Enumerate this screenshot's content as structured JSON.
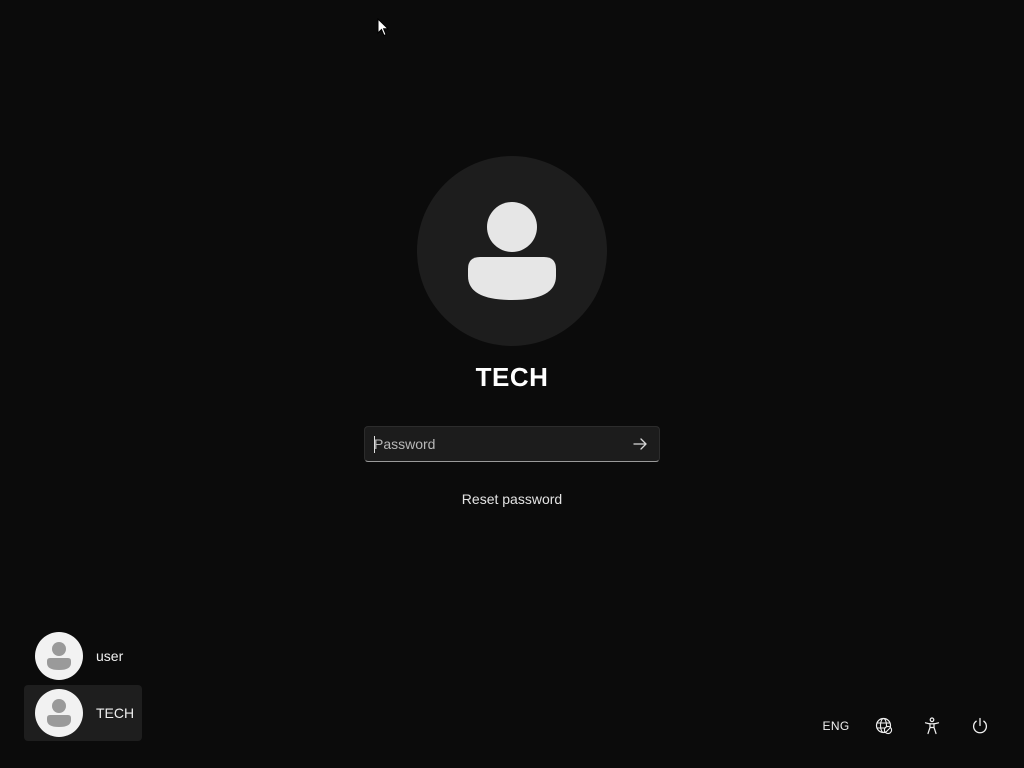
{
  "login": {
    "username": "TECH",
    "password_placeholder": "Password",
    "reset_label": "Reset password"
  },
  "user_switcher": [
    {
      "label": "user",
      "selected": false
    },
    {
      "label": "TECH",
      "selected": true
    }
  ],
  "tray": {
    "language": "ENG",
    "icons": [
      "network-icon",
      "accessibility-icon",
      "power-icon"
    ]
  },
  "colors": {
    "background": "#0b0b0b",
    "avatar_circle": "#1d1d1d",
    "avatar_glyph": "#e6e6e6",
    "input_background": "#1c1c1c",
    "selected_tile": "#1e1e1e"
  }
}
